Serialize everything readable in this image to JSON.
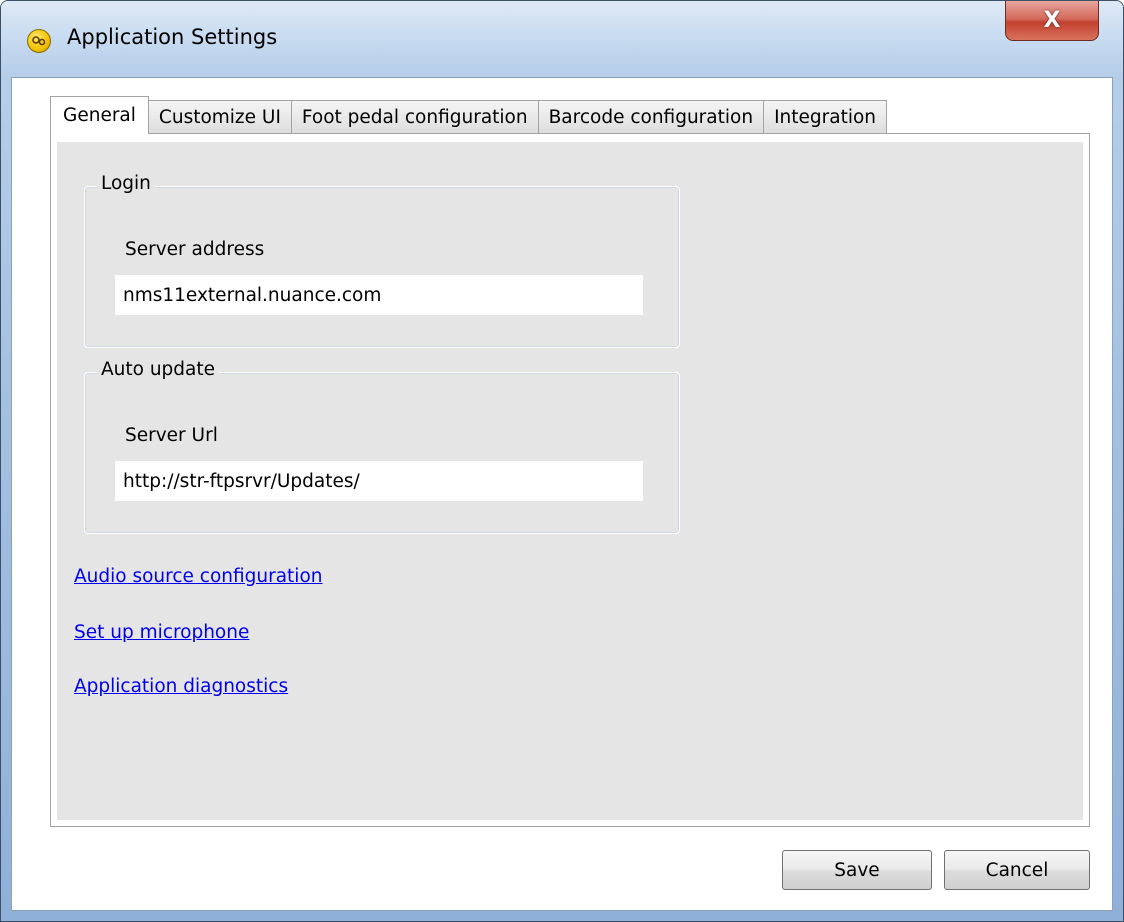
{
  "window": {
    "title": "Application Settings",
    "close_glyph": "X",
    "icon": "app-gear-icon"
  },
  "tabs": [
    {
      "label": "General",
      "active": true
    },
    {
      "label": "Customize UI",
      "active": false
    },
    {
      "label": "Foot pedal configuration",
      "active": false
    },
    {
      "label": "Barcode configuration",
      "active": false
    },
    {
      "label": "Integration",
      "active": false
    }
  ],
  "login": {
    "legend": "Login",
    "server_address_label": "Server address",
    "server_address_value": "nms11external.nuance.com"
  },
  "auto_update": {
    "legend": "Auto update",
    "server_url_label": "Server Url",
    "server_url_value": "http://str-ftpsrvr/Updates/"
  },
  "links": {
    "audio_source": "Audio source configuration",
    "microphone": "Set up microphone",
    "diagnostics": "Application diagnostics"
  },
  "buttons": {
    "save": "Save",
    "cancel": "Cancel"
  },
  "colors": {
    "link": "#0000ee",
    "panel_background": "#e5e5e5",
    "close_button": "#c2402f"
  }
}
